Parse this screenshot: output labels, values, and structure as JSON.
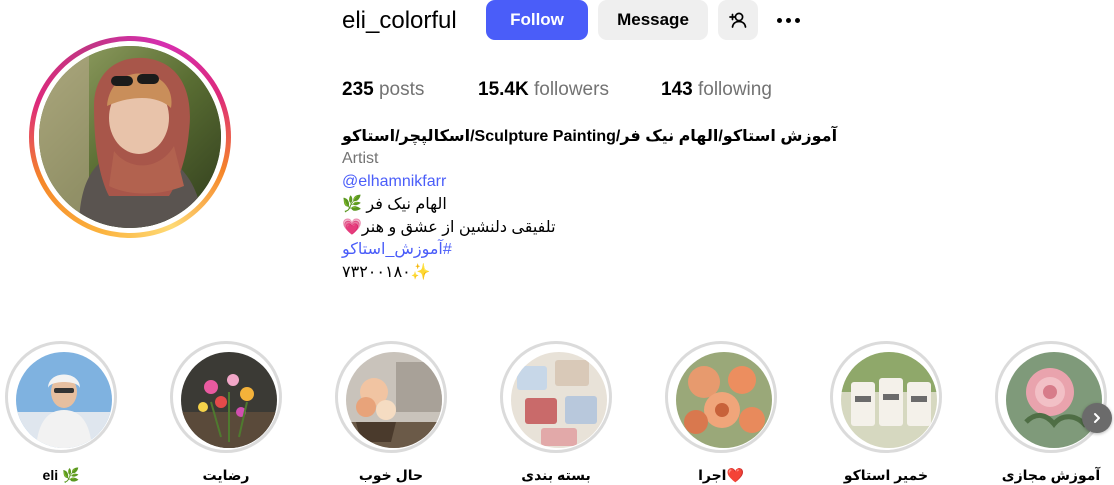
{
  "profile": {
    "username": "eli_colorful",
    "follow_label": "Follow",
    "message_label": "Message",
    "posts_count": "235",
    "posts_label": "posts",
    "followers_count": "15.4K",
    "followers_label": "followers",
    "following_count": "143",
    "following_label": "following"
  },
  "bio": {
    "name": "اسکالپچر/استاکو/Sculpture Painting/آموزش استاکو/الهام نیک فر",
    "category": "Artist",
    "handle": "@elhamnikfarr",
    "line1": "الهام نیک فر 🌿",
    "line2": "تلفیقی دلنشین از عشق و هنر💗",
    "hashtag": "#آموزش_استاکو",
    "number": "۷۳۲۰۰۱۸۰✨"
  },
  "highlights": [
    {
      "label": "eli 🌿"
    },
    {
      "label": "رضایت"
    },
    {
      "label": "حال خوب"
    },
    {
      "label": "بسته بندی"
    },
    {
      "label": "اجرا❤️"
    },
    {
      "label": "خمیر استاکو"
    },
    {
      "label": "آموزش مجازی"
    }
  ],
  "colors": {
    "accent": "#4a5df9",
    "button_secondary": "#efefef",
    "muted_text": "#737373",
    "highlight_ring": "#dbdbdb"
  },
  "icons": {
    "add_user": "add-user-icon",
    "more": "more-options-icon",
    "next": "chevron-right-icon"
  }
}
